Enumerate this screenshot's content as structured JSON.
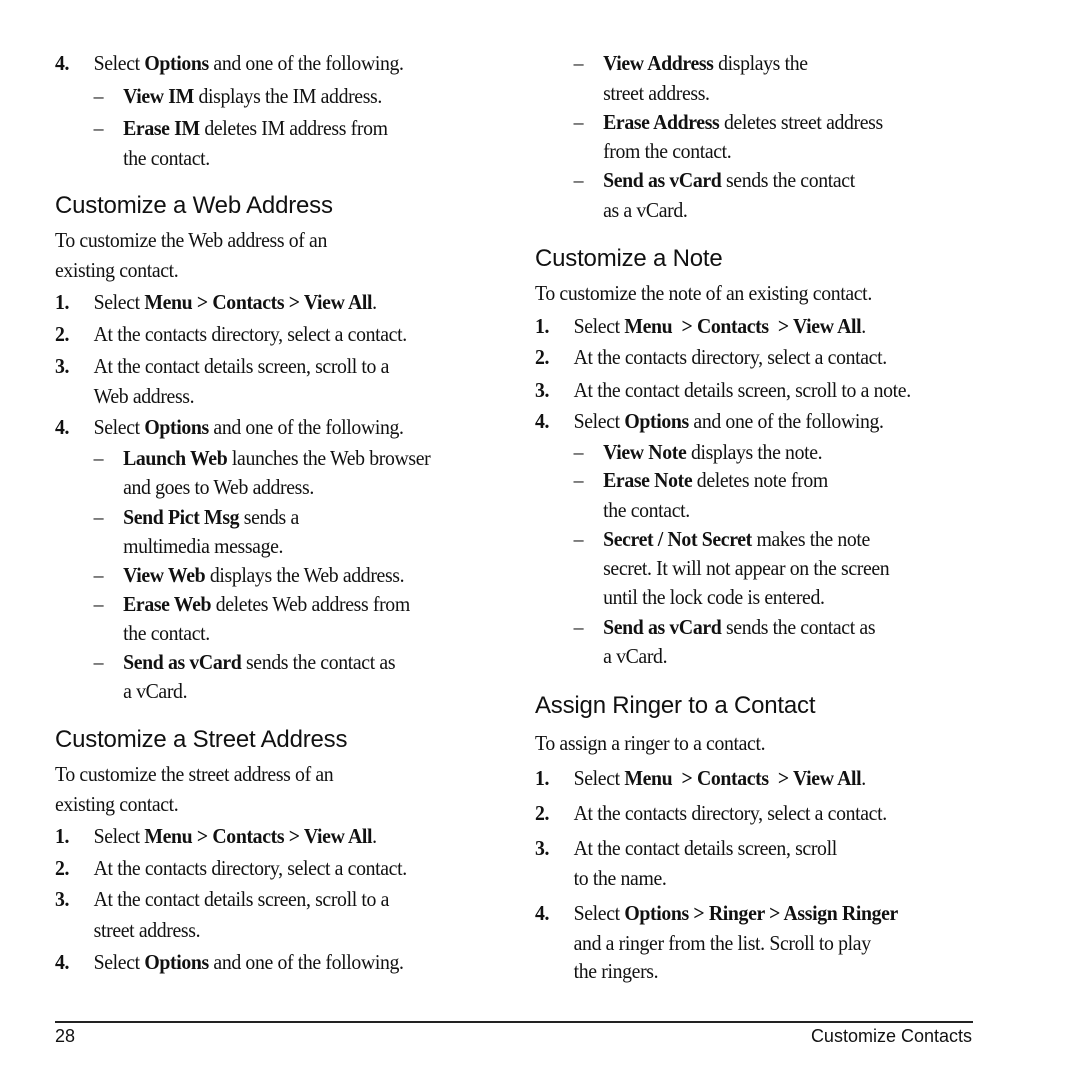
{
  "left": {
    "top_step": {
      "num": "4.",
      "pre": "Select ",
      "bold": "Options",
      "post": " and one of the following.",
      "subs": [
        {
          "bold": "View IM",
          "text": " displays the IM address.",
          "cont": ""
        },
        {
          "bold": "Erase IM",
          "text": " deletes IM address from",
          "cont": "the contact."
        }
      ]
    },
    "web": {
      "heading": "Customize a Web Address",
      "intro_1": "To customize the Web address of an",
      "intro_2": "existing contact.",
      "step1": {
        "num": "1.",
        "pre": "Select ",
        "bold": "Menu > Contacts > View All",
        "post": "."
      },
      "step2": {
        "num": "2.",
        "text": "At the contacts directory, select a contact."
      },
      "step3": {
        "num": "3.",
        "text": "At the contact details screen, scroll to a",
        "cont": "Web address."
      },
      "step4": {
        "num": "4.",
        "pre": "Select ",
        "bold": "Options",
        "post": " and one of the following."
      },
      "subs": [
        {
          "bold": "Launch Web",
          "text": " launches the Web browser",
          "cont": "and goes to Web address."
        },
        {
          "bold": "Send Pict Msg",
          "text": " sends a",
          "cont": "multimedia message."
        },
        {
          "bold": "View Web",
          "text": " displays the Web address.",
          "cont": ""
        },
        {
          "bold": "Erase Web",
          "text": " deletes Web address from",
          "cont": "the contact."
        },
        {
          "bold": "Send as vCard",
          "text": " sends the contact as",
          "cont": "a vCard."
        }
      ]
    },
    "street": {
      "heading": "Customize a Street Address",
      "intro_1": "To customize the street address of an",
      "intro_2": "existing contact.",
      "step1": {
        "num": "1.",
        "pre": "Select ",
        "bold": "Menu > Contacts > View All",
        "post": "."
      },
      "step2": {
        "num": "2.",
        "text": "At the contacts directory, select a contact."
      },
      "step3": {
        "num": "3.",
        "text": "At the contact details screen, scroll to a",
        "cont": "street address."
      },
      "step4": {
        "num": "4.",
        "pre": "Select ",
        "bold": "Options",
        "post": " and one of the following."
      }
    }
  },
  "right": {
    "street_subs": [
      {
        "bold": "View Address",
        "text": " displays the",
        "cont": "street address."
      },
      {
        "bold": "Erase Address",
        "text": " deletes street address",
        "cont": "from the contact."
      },
      {
        "bold": "Send as vCard",
        "text": " sends the contact",
        "cont": "as a vCard."
      }
    ],
    "note": {
      "heading": "Customize a Note",
      "intro": "To customize the note of an existing contact.",
      "step1": {
        "num": "1.",
        "pre": "Select ",
        "bold": "Menu  > Contacts  > View All",
        "post": "."
      },
      "step2": {
        "num": "2.",
        "text": "At the contacts directory, select a contact."
      },
      "step3": {
        "num": "3.",
        "text": "At the contact details screen, scroll to a note."
      },
      "step4": {
        "num": "4.",
        "pre": "Select ",
        "bold": "Options",
        "post": " and one of the following."
      },
      "subs": [
        {
          "bold": "View Note",
          "text": " displays the note.",
          "cont": "",
          "cont2": ""
        },
        {
          "bold": "Erase Note",
          "text": " deletes note from",
          "cont": "the contact.",
          "cont2": ""
        },
        {
          "bold": "Secret / Not Secret",
          "text": " makes the note",
          "cont": "secret. It will not appear on the screen",
          "cont2": "until the lock code is entered."
        },
        {
          "bold": "Send as vCard",
          "text": " sends the contact as",
          "cont": "a vCard.",
          "cont2": ""
        }
      ]
    },
    "ringer": {
      "heading": "Assign Ringer to a Contact",
      "intro": "To assign a ringer to a contact.",
      "step1": {
        "num": "1.",
        "pre": "Select ",
        "bold": "Menu  > Contacts  > View All",
        "post": "."
      },
      "step2": {
        "num": "2.",
        "text": "At the contacts directory, select a contact."
      },
      "step3": {
        "num": "3.",
        "text": "At the contact details screen, scroll",
        "cont": "to the name."
      },
      "step4": {
        "num": "4.",
        "pre": "Select ",
        "bold": "Options > Ringer > Assign Ringer",
        "post": "",
        "cont": "and a ringer from the list. Scroll to play",
        "cont2": "the ringers."
      }
    }
  },
  "dash": "–",
  "footer": {
    "page_number": "28",
    "section_title": "Customize Contacts"
  }
}
